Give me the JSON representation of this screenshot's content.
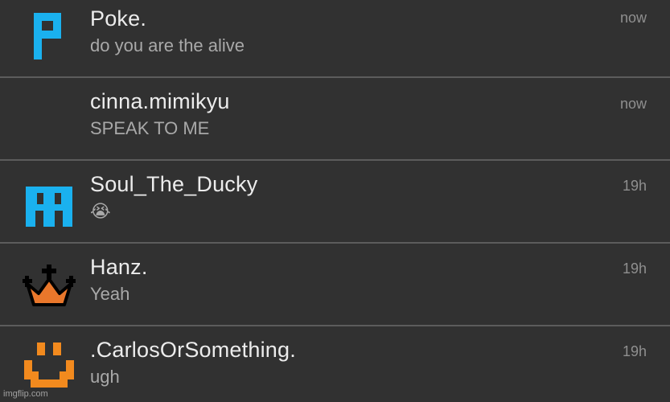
{
  "notifications": [
    {
      "name": "Poke.",
      "message": "do you are the alive",
      "time": "now",
      "avatar_icon": "blue-pixel-p-icon"
    },
    {
      "name": "cinna.mimikyu",
      "message": "SPEAK TO ME",
      "time": "now",
      "avatar_icon": "none"
    },
    {
      "name": "Soul_The_Ducky",
      "message": "😭",
      "time": "19h",
      "avatar_icon": "blue-pixel-invader-icon"
    },
    {
      "name": "Hanz.",
      "message": "Yeah",
      "time": "19h",
      "avatar_icon": "crown-icon"
    },
    {
      "name": ".CarlosOrSomething.",
      "message": "ugh",
      "time": "19h",
      "avatar_icon": "orange-smiley-icon"
    }
  ],
  "watermark": "imgflip.com",
  "colors": {
    "background": "#303030",
    "divider": "#5c5c5c",
    "name_text": "#ececec",
    "message_text": "#a9a9a9",
    "time_text": "#8f8f8f",
    "avatar_blue": "#1ab1ef",
    "avatar_orange": "#f28a1e",
    "crown_orange": "#e9772b"
  }
}
